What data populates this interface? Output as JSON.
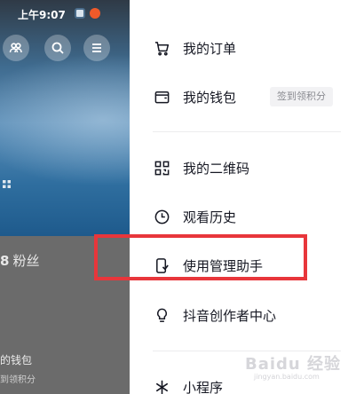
{
  "status_bar": {
    "time": "上午9:07"
  },
  "profile_background": {
    "fans_count": "8",
    "fans_label": "粉丝",
    "wallet_partial": "的钱包",
    "points_partial": "到领积分"
  },
  "drawer": {
    "items": [
      {
        "label": "我的订单",
        "icon": "cart-icon"
      },
      {
        "label": "我的钱包",
        "icon": "wallet-icon",
        "tag": "签到领积分"
      },
      {
        "label": "我的二维码",
        "icon": "qr-code-icon"
      },
      {
        "label": "观看历史",
        "icon": "clock-icon"
      },
      {
        "label": "使用管理助手",
        "icon": "phone-shield-icon"
      },
      {
        "label": "抖音创作者中心",
        "icon": "lightbulb-icon"
      },
      {
        "label": "小程序",
        "icon": "mini-program-icon"
      }
    ]
  },
  "annotation": {
    "color": "#e8363b",
    "target": "使用管理助手"
  },
  "watermark": {
    "text": "Baidu 经验",
    "sub": "jingyan.baidu.com"
  }
}
